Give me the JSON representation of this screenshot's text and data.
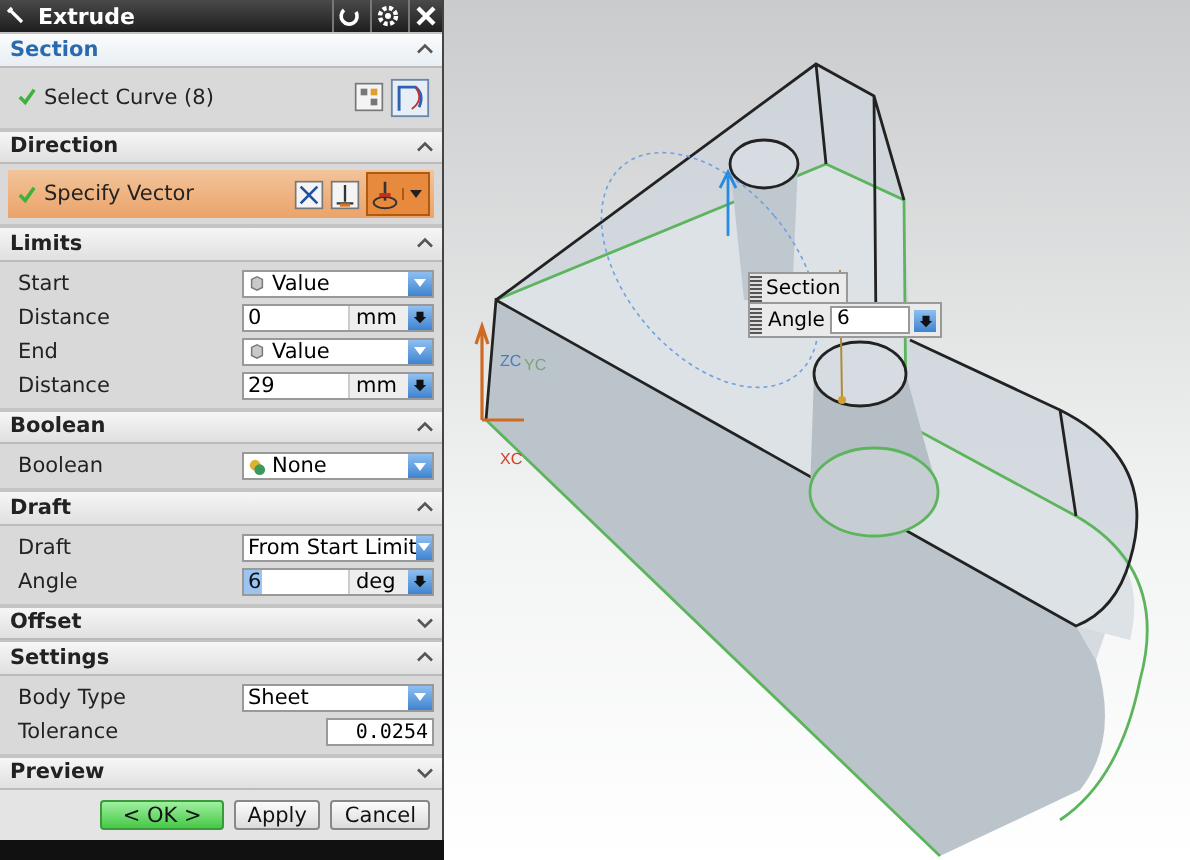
{
  "window": {
    "title": "Extrude"
  },
  "sections": [
    {
      "title": "Section",
      "expanded": true,
      "active": true,
      "rows": [
        {
          "kind": "selection",
          "label": "Select Curve (8)",
          "complete": true,
          "highlighted": false
        }
      ]
    },
    {
      "title": "Direction",
      "expanded": true,
      "active": false,
      "rows": [
        {
          "kind": "selection",
          "label": "Specify Vector",
          "complete": true,
          "highlighted": true
        }
      ]
    },
    {
      "title": "Limits",
      "expanded": true,
      "active": false,
      "rows": [
        {
          "kind": "dropdown",
          "label": "Start",
          "value": "Value"
        },
        {
          "kind": "unit_field",
          "label": "Distance",
          "value": "0",
          "unit": "mm",
          "highlighted": false
        },
        {
          "kind": "dropdown",
          "label": "End",
          "value": "Value"
        },
        {
          "kind": "unit_field",
          "label": "Distance",
          "value": "29",
          "unit": "mm",
          "highlighted": false
        }
      ]
    },
    {
      "title": "Boolean",
      "expanded": true,
      "active": false,
      "rows": [
        {
          "kind": "dropdown",
          "label": "Boolean",
          "value": "None"
        }
      ]
    },
    {
      "title": "Draft",
      "expanded": true,
      "active": false,
      "rows": [
        {
          "kind": "dropdown",
          "label": "Draft",
          "value": "From Start Limit"
        },
        {
          "kind": "unit_field",
          "label": "Angle",
          "value": "6",
          "unit": "deg",
          "highlighted": true
        }
      ]
    },
    {
      "title": "Offset",
      "expanded": false,
      "active": false
    },
    {
      "title": "Settings",
      "expanded": true,
      "active": false,
      "rows": [
        {
          "kind": "dropdown",
          "label": "Body Type",
          "value": "Sheet"
        },
        {
          "kind": "text_field",
          "label": "Tolerance",
          "value": "0.0254"
        }
      ]
    },
    {
      "title": "Preview",
      "expanded": false,
      "active": false
    }
  ],
  "buttons": [
    {
      "label": "< OK >",
      "default": true
    },
    {
      "label": "Apply",
      "default": false
    },
    {
      "label": "Cancel",
      "default": false
    }
  ],
  "viewport": {
    "axis_labels": [
      "ZC",
      "YC",
      "XC"
    ],
    "handle_label": "Section",
    "angle_field": {
      "label": "Angle",
      "value": "6"
    }
  }
}
